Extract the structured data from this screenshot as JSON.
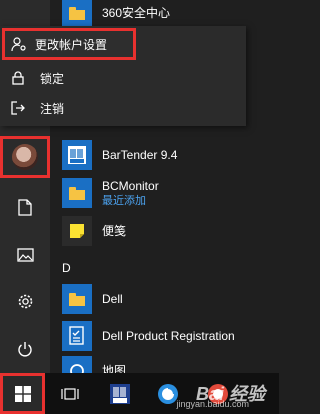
{
  "user_menu": {
    "items": [
      {
        "label": "更改帐户设置",
        "icon": "user-gear-icon"
      },
      {
        "label": "锁定",
        "icon": "lock-icon"
      },
      {
        "label": "注销",
        "icon": "sign-out-icon"
      }
    ]
  },
  "app_list": {
    "top_app": {
      "name": "360安全中心",
      "icon": "folder-icon"
    },
    "apps_b": [
      {
        "name": "BarTender 9.4",
        "icon": "bartender-icon"
      },
      {
        "name": "BCMonitor",
        "sub": "最近添加",
        "icon": "folder-icon"
      },
      {
        "name": "便笺",
        "icon": "sticky-notes-icon"
      }
    ],
    "letter_d": "D",
    "apps_d": [
      {
        "name": "Dell",
        "icon": "folder-icon"
      },
      {
        "name": "Dell Product Registration",
        "icon": "registration-icon"
      },
      {
        "name": "地图",
        "icon": "maps-icon"
      }
    ]
  },
  "watermark": {
    "text": "Bai 经验",
    "url": "jingyan.baidu.com"
  },
  "colors": {
    "highlight": "#e8312f",
    "accent_tile": "#1a6fc4",
    "folder": "#f6c343"
  }
}
